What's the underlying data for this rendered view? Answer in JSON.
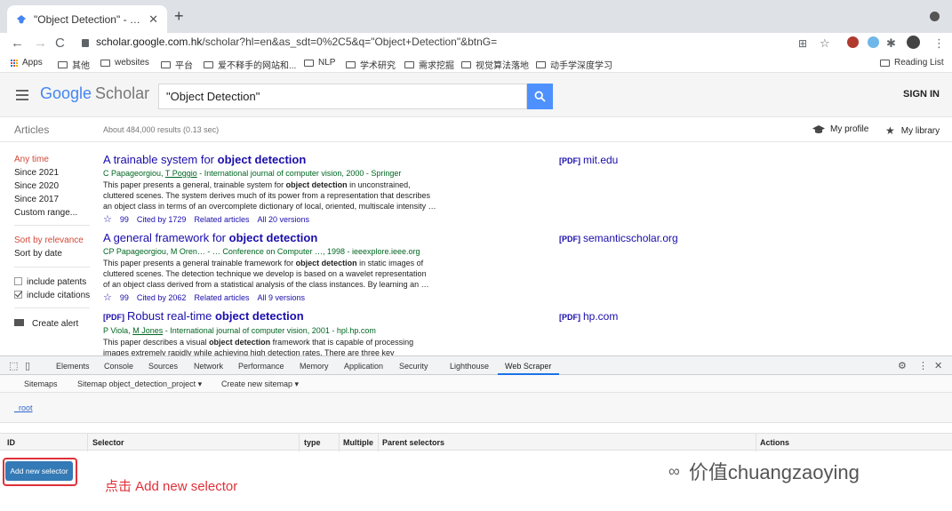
{
  "browser": {
    "tab_title": "\"Object Detection\" - Google Sc",
    "url_host": "scholar.google.com.hk",
    "url_path": "/scholar?hl=en&as_sdt=0%2C5&q=\"Object+Detection\"&btnG=",
    "bookmarks": [
      "Apps",
      "其他",
      "websites",
      "平台",
      "爱不释手的网站和...",
      "NLP",
      "学术研究",
      "需求挖掘",
      "视觉算法落地",
      "动手学深度学习"
    ],
    "reading_list": "Reading List"
  },
  "scholar": {
    "logo_google": "Google",
    "logo_scholar": "Scholar",
    "query": "\"Object Detection\"",
    "sign_in": "SIGN IN",
    "articles": "Articles",
    "result_stats": "About 484,000 results (0.13 sec)",
    "my_profile": "My profile",
    "my_library": "My library"
  },
  "sidebar": {
    "time": [
      "Any time",
      "Since 2021",
      "Since 2020",
      "Since 2017",
      "Custom range..."
    ],
    "sort": [
      "Sort by relevance",
      "Sort by date"
    ],
    "include_patents": "include patents",
    "include_citations": "include citations",
    "create_alert": "Create alert"
  },
  "results": [
    {
      "title_pre": "A trainable system for ",
      "title_bold": "object detection",
      "authors_pre": "C Papageorgiou, ",
      "authors_link": "T Poggio",
      "authors_post": " - International journal of computer vision, 2000 - Springer",
      "snippet": [
        "This paper presents a general, trainable system for object detection in unconstrained,",
        "cluttered scenes. The system derives much of its power from a representation that describes",
        "an object class in terms of an overcomplete dictionary of local, oriented, multiscale intensity …"
      ],
      "cite_symbol": "99",
      "cited_by": "Cited by 1729",
      "related": "Related articles",
      "versions": "All 20 versions",
      "pdf_tag": "[PDF]",
      "pdf_host": "mit.edu"
    },
    {
      "title_pre": "A general framework for ",
      "title_bold": "object detection",
      "authors_pre": "CP Papageorgiou, M Oren… - … Conference on Computer …, 1998 - ieeexplore.ieee.org",
      "authors_link": "",
      "authors_post": "",
      "snippet": [
        "This paper presents a general trainable framework for object detection in static images of",
        "cluttered scenes. The detection technique we develop is based on a wavelet representation",
        "of an object class derived from a statistical analysis of the class instances. By learning an …"
      ],
      "cite_symbol": "99",
      "cited_by": "Cited by 2062",
      "related": "Related articles",
      "versions": "All 9 versions",
      "pdf_tag": "[PDF]",
      "pdf_host": "semanticscholar.org"
    },
    {
      "tag": "[PDF]",
      "title_pre": "Robust real-time ",
      "title_bold": "object detection",
      "authors_pre": "P Viola, ",
      "authors_link": "M Jones",
      "authors_post": " - International journal of computer vision, 2001 - hpl.hp.com",
      "snippet": [
        "This paper describes a visual object detection framework that is capable of processing",
        "images extremely rapidly while achieving high detection rates. There are three key"
      ],
      "pdf_tag": "[PDF]",
      "pdf_host": "hp.com"
    }
  ],
  "devtools": {
    "tabs": [
      "Elements",
      "Console",
      "Sources",
      "Network",
      "Performance",
      "Memory",
      "Application",
      "Security",
      "Lighthouse",
      "Web Scraper"
    ],
    "active_tab": "Web Scraper",
    "subnav": [
      "Sitemaps",
      "Sitemap object_detection_project ▾",
      "Create new sitemap ▾"
    ],
    "breadcrumb": "_root",
    "columns": [
      "ID",
      "Selector",
      "type",
      "Multiple",
      "Parent selectors",
      "Actions"
    ],
    "add_button": "Add new selector"
  },
  "annotation": "点击 Add new selector",
  "watermark": "价值chuangzaoying",
  "colors": {
    "accent": "#4d90fe",
    "link": "#1a0dab",
    "green": "#006621",
    "red": "#d14836",
    "highlight": "#e0303a"
  }
}
